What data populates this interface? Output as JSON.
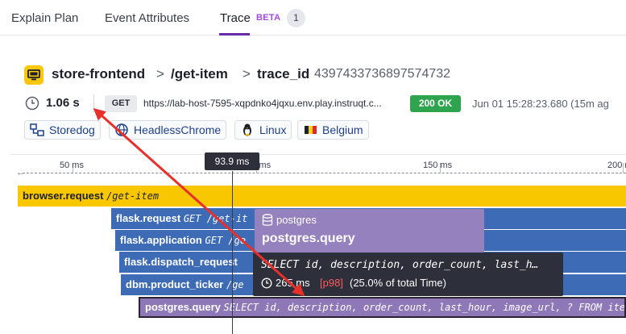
{
  "tabs": {
    "explain_plan": "Explain Plan",
    "event_attributes": "Event Attributes",
    "trace": "Trace",
    "beta": "BETA",
    "count": "1"
  },
  "header": {
    "service": "store-frontend",
    "resource": "/get-item",
    "trace_label": "trace_id",
    "trace_id": "4397433736897574732",
    "separator": ">"
  },
  "meta": {
    "duration": "1.06 s",
    "method": "GET",
    "url": "https://lab-host-7595-xqpdnko4jqxu.env.play.instruqt.c...",
    "status": "200 OK",
    "timestamp": "Jun 01 15:28:23.680 (15m ag"
  },
  "tags": [
    {
      "label": "Storedog",
      "icon": "service-map-icon"
    },
    {
      "label": "HeadlessChrome",
      "icon": "globe-icon"
    },
    {
      "label": "Linux",
      "icon": "linux-icon"
    },
    {
      "label": "Belgium",
      "icon": "belgium-flag-icon"
    }
  ],
  "timeline": {
    "ticks": [
      "50 ms",
      "100 ms",
      "150 ms",
      "200 ms"
    ],
    "cursor": "93.9 ms",
    "spans": [
      {
        "name": "browser.request",
        "resource": "/get-item"
      },
      {
        "name": "flask.request",
        "resource": "GET /get-it"
      },
      {
        "name": "flask.application",
        "resource": "GET /ge"
      },
      {
        "name": "flask.dispatch_request",
        "resource": ""
      },
      {
        "name": "dbm.product_ticker",
        "resource": "/ge"
      },
      {
        "name": "postgres.query",
        "resource": "SELECT id, description, order_count, last_hour, image_url, ? FROM ite"
      }
    ]
  },
  "hover": {
    "service": "postgres",
    "operation": "postgres.query"
  },
  "tooltip": {
    "query": "SELECT id, description, order_count, last_h…",
    "duration": "265 ms",
    "percentile": "[p98]",
    "share": "(25.0% of total Time)"
  },
  "colors": {
    "accent": "#632ca6",
    "browser_span": "#f8c700",
    "flask_span": "#3e6bb5",
    "postgres_span": "#8f78b8",
    "status_ok": "#2ea44f",
    "annotation_arrow": "#e8302a"
  }
}
